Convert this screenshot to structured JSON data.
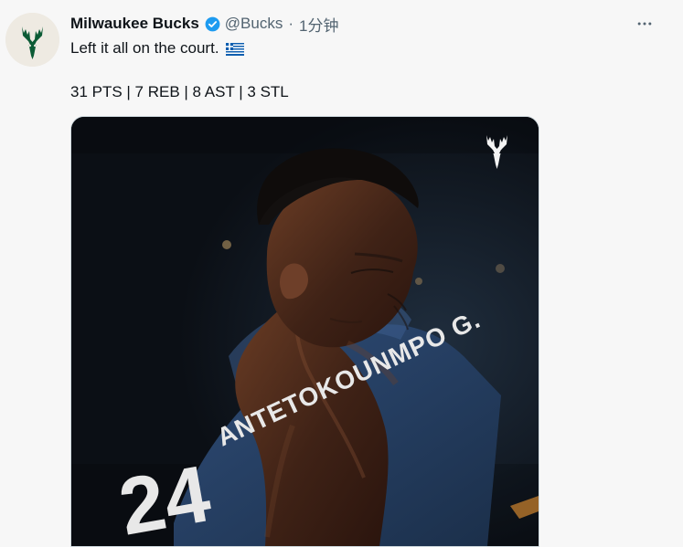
{
  "tweet": {
    "author": {
      "display_name": "Milwaukee Bucks",
      "handle": "@Bucks",
      "separator": "·",
      "timestamp": "1分钟",
      "avatar_icon": "bucks-logo-icon",
      "verified_icon": "verified-badge-icon"
    },
    "text_line_1": "Left it all on the court.",
    "text_line_2": "31 PTS | 7 REB | 8 AST | 3 STL",
    "emoji_icon": "greece-flag-icon",
    "media": {
      "watermark_icon": "bucks-logo-icon",
      "jersey_text": "ANTETOKOUNMPO G."
    },
    "more_icon": "more-icon"
  }
}
